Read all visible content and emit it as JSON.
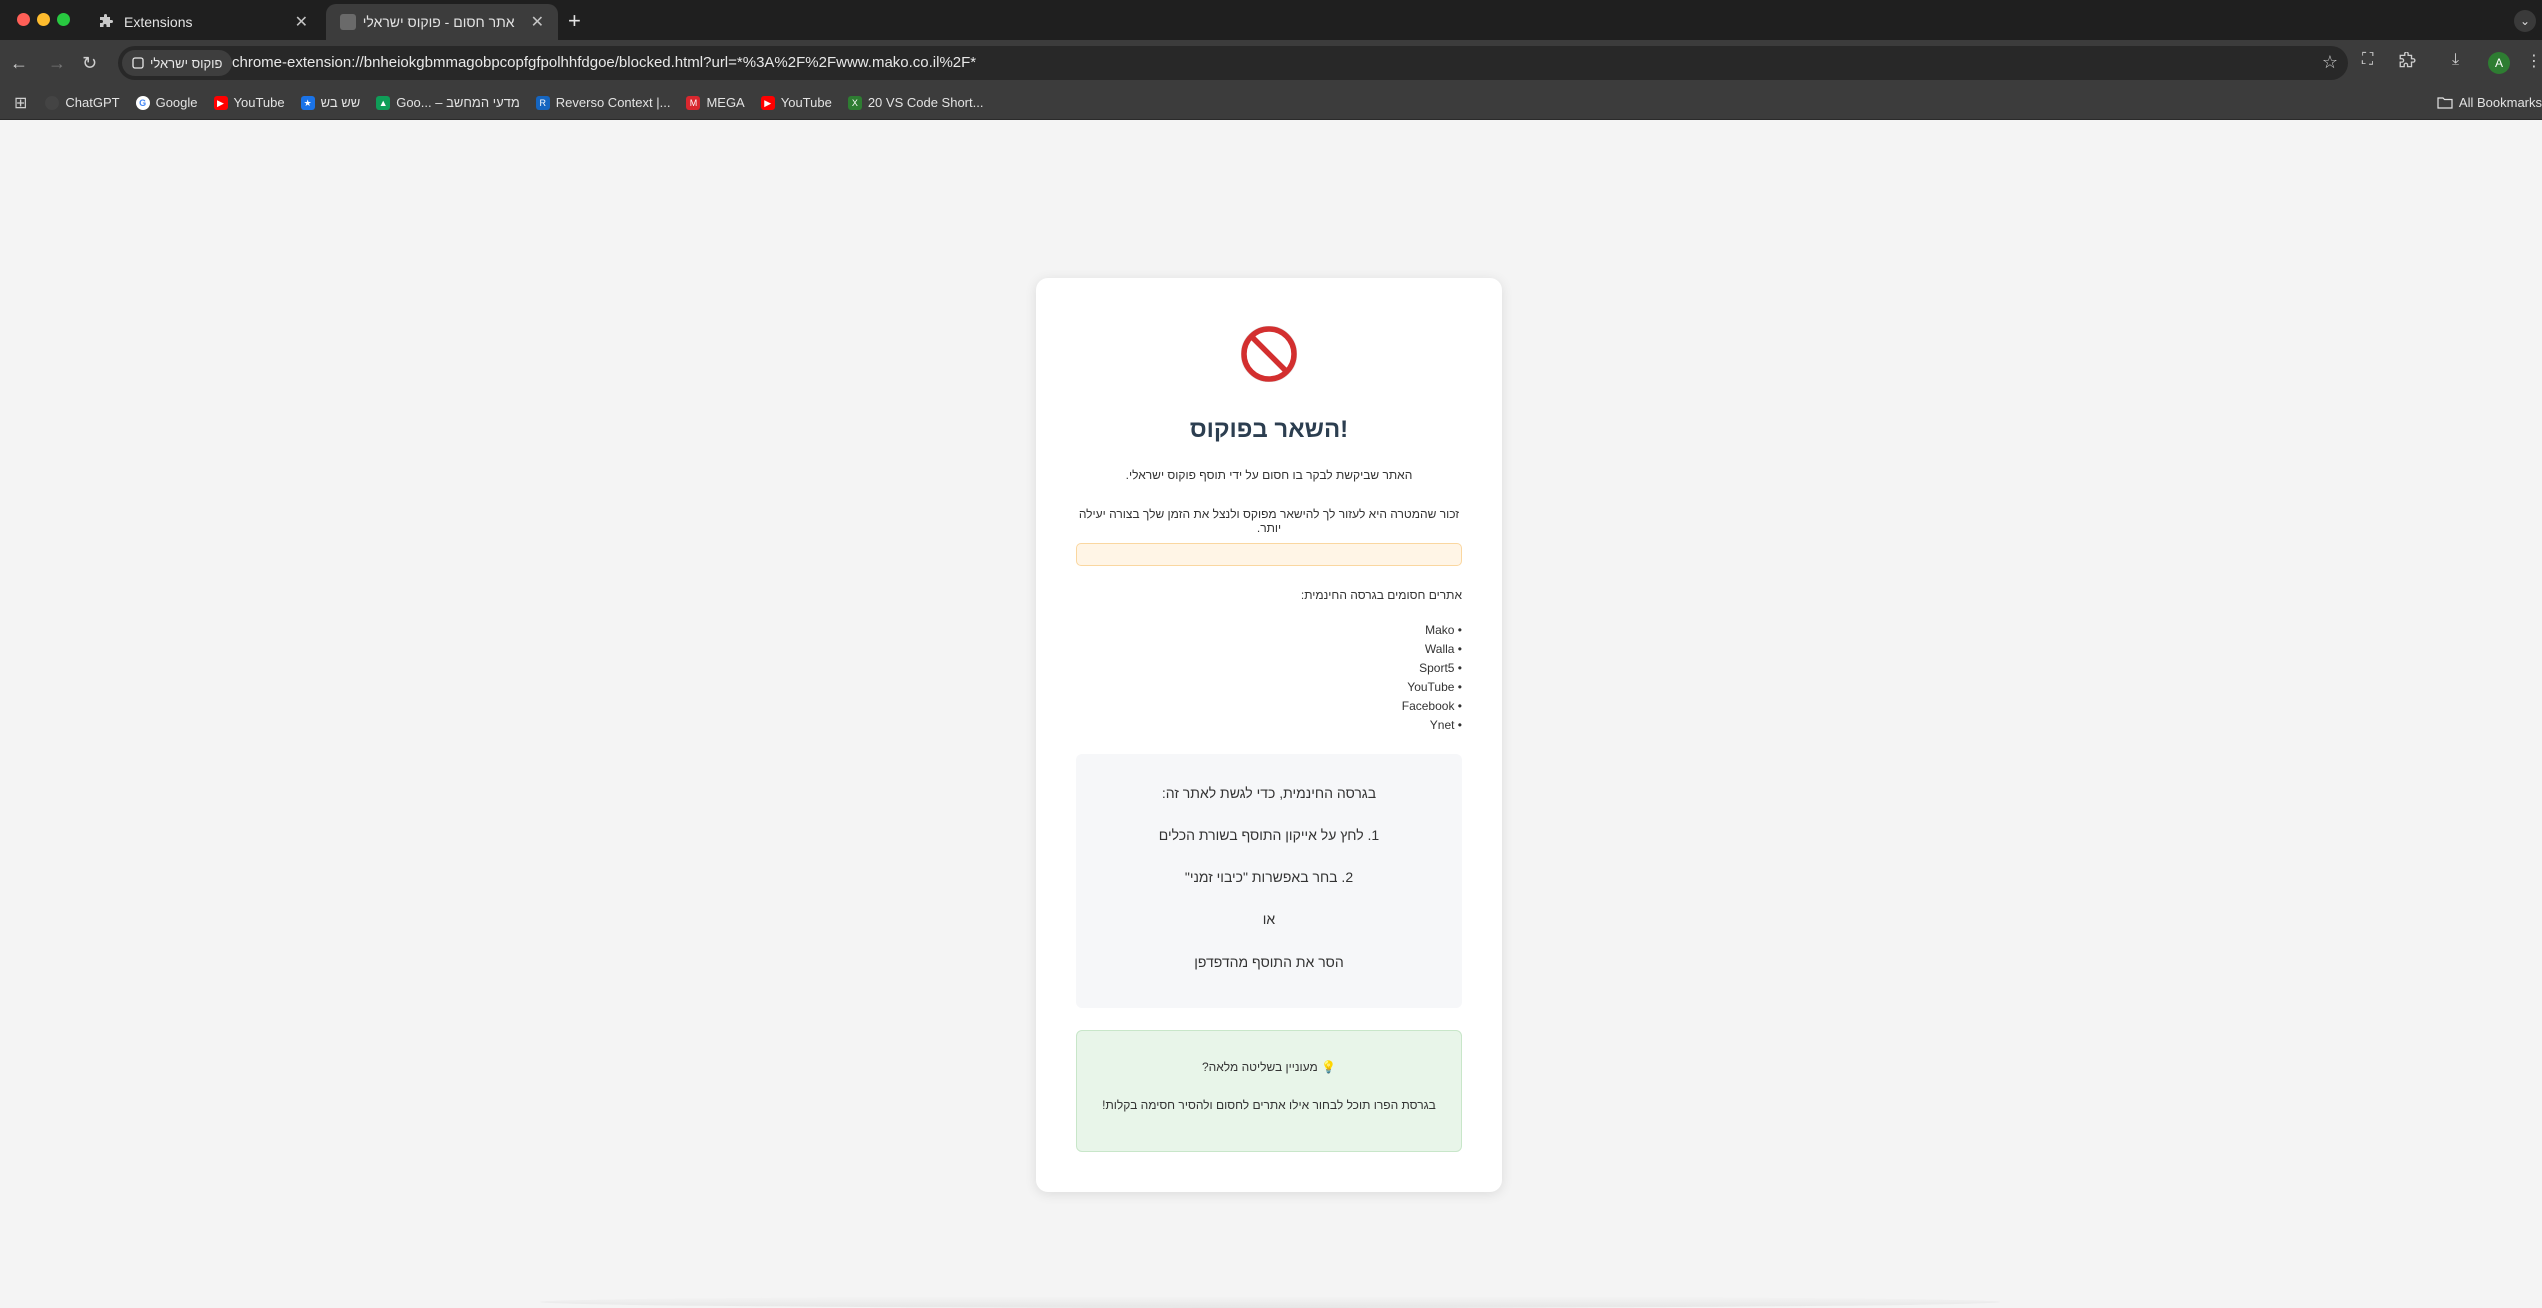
{
  "browser": {
    "tabs": [
      {
        "title": "Extensions",
        "icon": "puzzle-icon",
        "active": false
      },
      {
        "title": "אתר חסום - פוקוס ישראלי",
        "icon": "page-icon",
        "active": true
      }
    ],
    "new_tab_label": "+",
    "site_chip": "פוקוס ישראלי",
    "url": "chrome-extension://bnheiokgbmmagobpcopfgfpolhhfdgoe/blocked.html?url=*%3A%2F%2Fwww.mako.co.il%2F*",
    "avatar_letter": "A",
    "bookmarks": [
      {
        "label": "ChatGPT",
        "icon": "chatgpt-icon",
        "color": "#444444"
      },
      {
        "label": "Google",
        "icon": "google-icon",
        "color": "#4285f4"
      },
      {
        "label": "YouTube",
        "icon": "youtube-icon",
        "color": "#ff0000"
      },
      {
        "label": "שש בש",
        "icon": "star-icon",
        "color": "#1a73e8"
      },
      {
        "label": "Goo... – מדעי המחשב",
        "icon": "drive-icon",
        "color": "#0f9d58"
      },
      {
        "label": "Reverso Context |...",
        "icon": "reverso-icon",
        "color": "#1565c0"
      },
      {
        "label": "MEGA",
        "icon": "mega-icon",
        "color": "#d9272e"
      },
      {
        "label": "YouTube",
        "icon": "youtube-icon",
        "color": "#ff0000"
      },
      {
        "label": "20 VS Code Short...",
        "icon": "vscode-icon",
        "color": "#2e7d32"
      }
    ],
    "all_bookmarks_label": "All Bookmarks"
  },
  "page": {
    "title": "השאר בפוקוס!",
    "message": "האתר שביקשת לבקר בו חסום על ידי תוסף פוקוס ישראלי.",
    "reminder": "זכור שהמטרה היא לעזור לך להישאר מפוקס ולנצל את הזמן שלך בצורה יעילה יותר.",
    "blocked_heading": "אתרים חסומים בגרסה החינמית:",
    "blocked_sites": [
      "• Mako",
      "• Walla",
      "• Sport5",
      "• YouTube",
      "• Facebook",
      "• Ynet"
    ],
    "instructions": {
      "intro": "בגרסה החינמית, כדי לגשת לאתר זה:",
      "step1": "1. לחץ על אייקון התוסף בשורת הכלים",
      "step2": "2. בחר באפשרות \"כיבוי זמני\"",
      "or": "או",
      "alt": "הסר את התוסף מהדפדפן"
    },
    "pro": {
      "heading": "💡 מעוניין בשליטה מלאה?",
      "text": "בגרסת הפרו תוכל לבחור אילו אתרים לחסום ולהסיר חסימה בקלות!"
    },
    "colors": {
      "title": "#2c3e50",
      "stop_sign": "#d32f2f",
      "warning_bg": "#fff5e6",
      "pro_bg": "#e8f5e9"
    }
  }
}
